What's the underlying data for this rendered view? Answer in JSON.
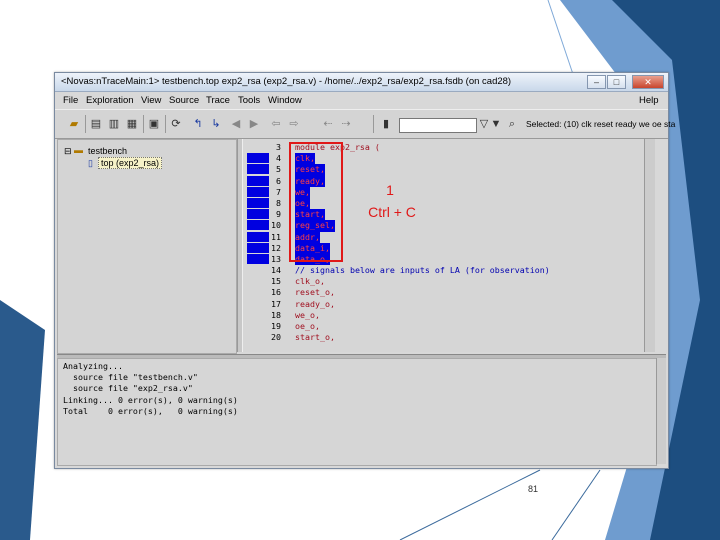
{
  "window": {
    "title": "<Novas:nTraceMain:1> testbench.top exp2_rsa (exp2_rsa.v) - /home/../exp2_rsa/exp2_rsa.fsdb (on cad28)",
    "buttons": {
      "minimize": "–",
      "maximize": "□",
      "close": "✕"
    }
  },
  "menu": [
    {
      "label": "File",
      "underline": "F"
    },
    {
      "label": "Exploration",
      "underline": "E"
    },
    {
      "label": "View",
      "underline": "V"
    },
    {
      "label": "Source",
      "underline": "S"
    },
    {
      "label": "Trace",
      "underline": "T"
    },
    {
      "label": "Tools",
      "underline": "T"
    },
    {
      "label": "Window",
      "underline": "W"
    },
    {
      "label": "Help",
      "underline": "H"
    }
  ],
  "toolbar": {
    "icons": [
      "open-folder-icon",
      "hierarchy-icon",
      "signal-list-icon",
      "waveform-icon",
      "schematic-icon",
      "trace-driver-icon",
      "trace-back-icon",
      "trace-forward-icon",
      "back-arrow-icon",
      "forward-arrow-icon",
      "undo-icon",
      "redo-icon",
      "copy-icon",
      "paste-icon",
      "battery-icon",
      "search-combo-icon",
      "filter-icon",
      "search-icon",
      "settings-icon"
    ],
    "selected_label": "Selected: (10) clk reset ready we oe sta"
  },
  "tree": {
    "root": "testbench",
    "child": "top (exp2_rsa)"
  },
  "source": {
    "lines": [
      {
        "num": "3",
        "text": "module exp2_rsa (",
        "selected": false
      },
      {
        "num": "4",
        "text": "clk,",
        "selected": true
      },
      {
        "num": "5",
        "text": "reset,",
        "selected": true
      },
      {
        "num": "6",
        "text": "ready,",
        "selected": true
      },
      {
        "num": "7",
        "text": "we,",
        "selected": true
      },
      {
        "num": "8",
        "text": "oe,",
        "selected": true
      },
      {
        "num": "9",
        "text": "start,",
        "selected": true
      },
      {
        "num": "10",
        "text": "reg_sel,",
        "selected": true
      },
      {
        "num": "11",
        "text": "addr,",
        "selected": true
      },
      {
        "num": "12",
        "text": "data_i,",
        "selected": true
      },
      {
        "num": "13",
        "text": "data_o,",
        "selected": true
      },
      {
        "num": "14",
        "text": "// signals below are inputs of LA (for observation)",
        "selected": false,
        "comment": true
      },
      {
        "num": "15",
        "text": "clk_o,",
        "selected": false
      },
      {
        "num": "16",
        "text": "reset_o,",
        "selected": false
      },
      {
        "num": "17",
        "text": "ready_o,",
        "selected": false
      },
      {
        "num": "18",
        "text": "we_o,",
        "selected": false
      },
      {
        "num": "19",
        "text": "oe_o,",
        "selected": false
      },
      {
        "num": "20",
        "text": "start_o,",
        "selected": false
      }
    ]
  },
  "console": {
    "lines": [
      "Analyzing...",
      "  source file \"testbench.v\"",
      "  source file \"exp2_rsa.v\"",
      "Linking... 0 error(s), 0 warning(s)",
      "Total    0 error(s),   0 warning(s)"
    ]
  },
  "annotation": {
    "step": "1",
    "shortcut": "Ctrl + C",
    "color": "#e01818"
  },
  "page_number": "81",
  "colors": {
    "selection": "#0000e0",
    "keyword": "#a01020",
    "deco_blue_dark": "#1f4f7f",
    "deco_blue_light": "#7fa9d8"
  }
}
